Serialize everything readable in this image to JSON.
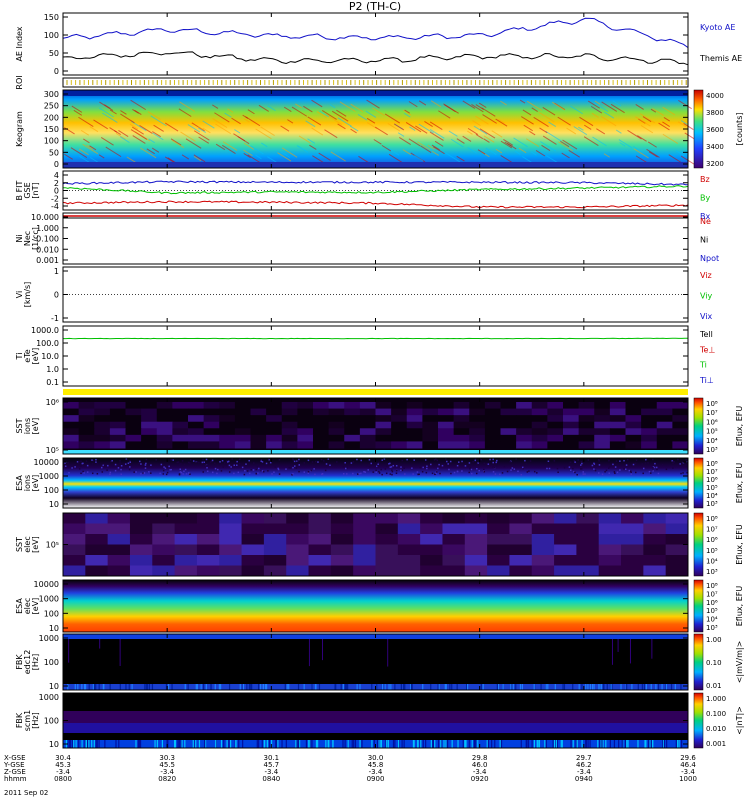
{
  "title": "P2 (TH-C)",
  "date_label": "2011 Sep 02",
  "time_axis": {
    "rows": [
      {
        "label": "X-GSE",
        "values": [
          "30.4",
          "30.3",
          "30.1",
          "30.0",
          "29.8",
          "29.7",
          "29.6"
        ]
      },
      {
        "label": "Y-GSE",
        "values": [
          "45.3",
          "45.5",
          "45.7",
          "45.8",
          "46.0",
          "46.2",
          "46.4"
        ]
      },
      {
        "label": "Z-GSE",
        "values": [
          "-3.4",
          "-3.4",
          "-3.4",
          "-3.4",
          "-3.4",
          "-3.4",
          "-3.4"
        ]
      },
      {
        "label": "hhmm",
        "values": [
          "0800",
          "0820",
          "0840",
          "0900",
          "0920",
          "0940",
          "1000"
        ]
      }
    ]
  },
  "colors": {
    "blue": "#1010c8",
    "green": "#00c000",
    "red": "#d00000",
    "black": "#000000",
    "yellow": "#ffee00"
  },
  "panels": {
    "ae": {
      "ylabel": "AE Index",
      "ticks": [
        "150",
        "100",
        "50",
        "0"
      ],
      "legend": [
        {
          "text": "Kyoto AE",
          "color": "#1010c8"
        },
        {
          "text": "Themis AE",
          "color": "#000000"
        }
      ]
    },
    "roi": {
      "ylabel": "ROI"
    },
    "keogram": {
      "ylabel": "Keogram",
      "ticks": [
        "300",
        "250",
        "200",
        "150",
        "100",
        "50",
        "0"
      ],
      "cbar_ticks": [
        "4000",
        "3800",
        "3600",
        "3400",
        "3200"
      ],
      "cbar_label": "[counts]"
    },
    "bfield": {
      "ylabel": "B FIT",
      "ylabel2": "GSE",
      "unit": "[nT]",
      "ticks": [
        "4",
        "2",
        "0",
        "-2",
        "-4"
      ],
      "legend": [
        {
          "text": "Bz",
          "color": "#d00000"
        },
        {
          "text": "By",
          "color": "#00c000"
        },
        {
          "text": "Bx",
          "color": "#1010c8"
        }
      ]
    },
    "density": {
      "ylabel": "Ni",
      "ylabel2": "Nec",
      "unit": "[1/cc]",
      "ticks": [
        "10.000",
        "1.000",
        "0.100",
        "0.010",
        "0.001"
      ],
      "legend": [
        {
          "text": "Ne",
          "color": "#d00000"
        },
        {
          "text": "Ni",
          "color": "#000000"
        },
        {
          "text": "Npot",
          "color": "#1010c8"
        }
      ]
    },
    "velocity": {
      "ylabel": "Vi",
      "unit": "[km/s]",
      "ticks": [
        "1",
        "0",
        "-1"
      ],
      "legend": [
        {
          "text": "Viz",
          "color": "#d00000"
        },
        {
          "text": "Viy",
          "color": "#00c000"
        },
        {
          "text": "Vix",
          "color": "#1010c8"
        }
      ]
    },
    "temperature": {
      "ylabel": "Ti",
      "ylabel2": "eTe",
      "unit": "[eV]",
      "ticks": [
        "1000.0",
        "100.0",
        "10.0",
        "1.0",
        "0.1"
      ],
      "legend": [
        {
          "text": "Tell",
          "color": "#000000"
        },
        {
          "text": "Te⊥",
          "color": "#d00000"
        },
        {
          "text": "Ti",
          "color": "#00c000"
        },
        {
          "text": "Ti⊥",
          "color": "#1010c8"
        }
      ]
    },
    "sst_i": {
      "ylabel": "SST",
      "ylabel2": "ions",
      "unit": "[eV]",
      "ticks": [
        "10⁶",
        "10⁵"
      ]
    },
    "esa_i": {
      "ylabel": "ESA",
      "ylabel2": "ions",
      "unit": "[eV]",
      "ticks": [
        "10000",
        "1000",
        "100",
        "10"
      ]
    },
    "sst_e": {
      "ylabel": "SST",
      "ylabel2": "elec",
      "unit": "[eV]",
      "ticks": [
        "10⁵"
      ]
    },
    "esa_e": {
      "ylabel": "ESA",
      "ylabel2": "elec",
      "unit": "[eV]",
      "ticks": [
        "10000",
        "1000",
        "100",
        "10"
      ]
    },
    "fbk_e": {
      "ylabel": "FBK",
      "ylabel2": "edc12",
      "unit": "[Hz]",
      "ticks": [
        "1000",
        "100",
        "10"
      ]
    },
    "fbk_b": {
      "ylabel": "FBK",
      "ylabel2": "scm1",
      "unit": "[Hz]",
      "ticks": [
        "1000",
        "100",
        "10"
      ]
    }
  },
  "colorbars": {
    "eflux1": {
      "ticks": [
        "10⁸",
        "10⁷",
        "10⁶",
        "10⁵",
        "10⁴",
        "10³"
      ],
      "label": "Eflux, EFU"
    },
    "eflux2": {
      "ticks": [
        "10⁸",
        "10⁷",
        "10⁶",
        "10⁵",
        "10⁴",
        "10³"
      ],
      "label": "Eflux, EFU"
    },
    "eflux3": {
      "ticks": [
        "10⁸",
        "10⁷",
        "10⁶",
        "10⁵",
        "10⁴",
        "10³"
      ],
      "label": "Eflux, EFU"
    },
    "eflux4": {
      "ticks": [
        "10⁸",
        "10⁷",
        "10⁶",
        "10⁵",
        "10⁴",
        "10³"
      ],
      "label": "Eflux, EFU"
    },
    "fbk_e": {
      "ticks": [
        "1.00",
        "0.10",
        "0.01"
      ],
      "label": "<|mV/m|>"
    },
    "fbk_b": {
      "ticks": [
        "1.000",
        "0.100",
        "0.010",
        "0.001"
      ],
      "label": "<|nT|>"
    }
  },
  "chart_data": [
    {
      "type": "line",
      "panel": "AE Index",
      "x": [
        "0800",
        "0820",
        "0840",
        "0900",
        "0920",
        "0940",
        "1000"
      ],
      "ylim": [
        0,
        150
      ],
      "series": [
        {
          "name": "Kyoto AE",
          "values": [
            88,
            110,
            95,
            90,
            95,
            135,
            70
          ]
        },
        {
          "name": "Themis AE",
          "values": [
            40,
            55,
            35,
            35,
            45,
            45,
            30
          ]
        }
      ]
    },
    {
      "type": "line",
      "panel": "B FIT GSE [nT]",
      "x": [
        "0800",
        "0820",
        "0840",
        "0900",
        "0920",
        "0940",
        "1000"
      ],
      "ylim": [
        -4,
        4
      ],
      "series": [
        {
          "name": "Bz",
          "values": [
            -2.6,
            -2.3,
            -2.4,
            -2.6,
            -3.4,
            -3.4,
            -3.0
          ]
        },
        {
          "name": "By",
          "values": [
            0.6,
            -0.5,
            -0.3,
            -0.4,
            0.2,
            0.5,
            0.9
          ]
        },
        {
          "name": "Bx",
          "values": [
            1.4,
            1.8,
            1.7,
            1.7,
            1.7,
            1.6,
            1.2
          ]
        }
      ]
    },
    {
      "type": "line",
      "panel": "Ti eTe [eV]",
      "x": [
        "0800",
        "0820",
        "0840",
        "0900",
        "0920",
        "0940",
        "1000"
      ],
      "ylim": [
        0.1,
        1000
      ],
      "yscale": "log",
      "series": [
        {
          "name": "Ti",
          "values": [
            220,
            220,
            220,
            220,
            220,
            220,
            230
          ]
        }
      ]
    }
  ]
}
